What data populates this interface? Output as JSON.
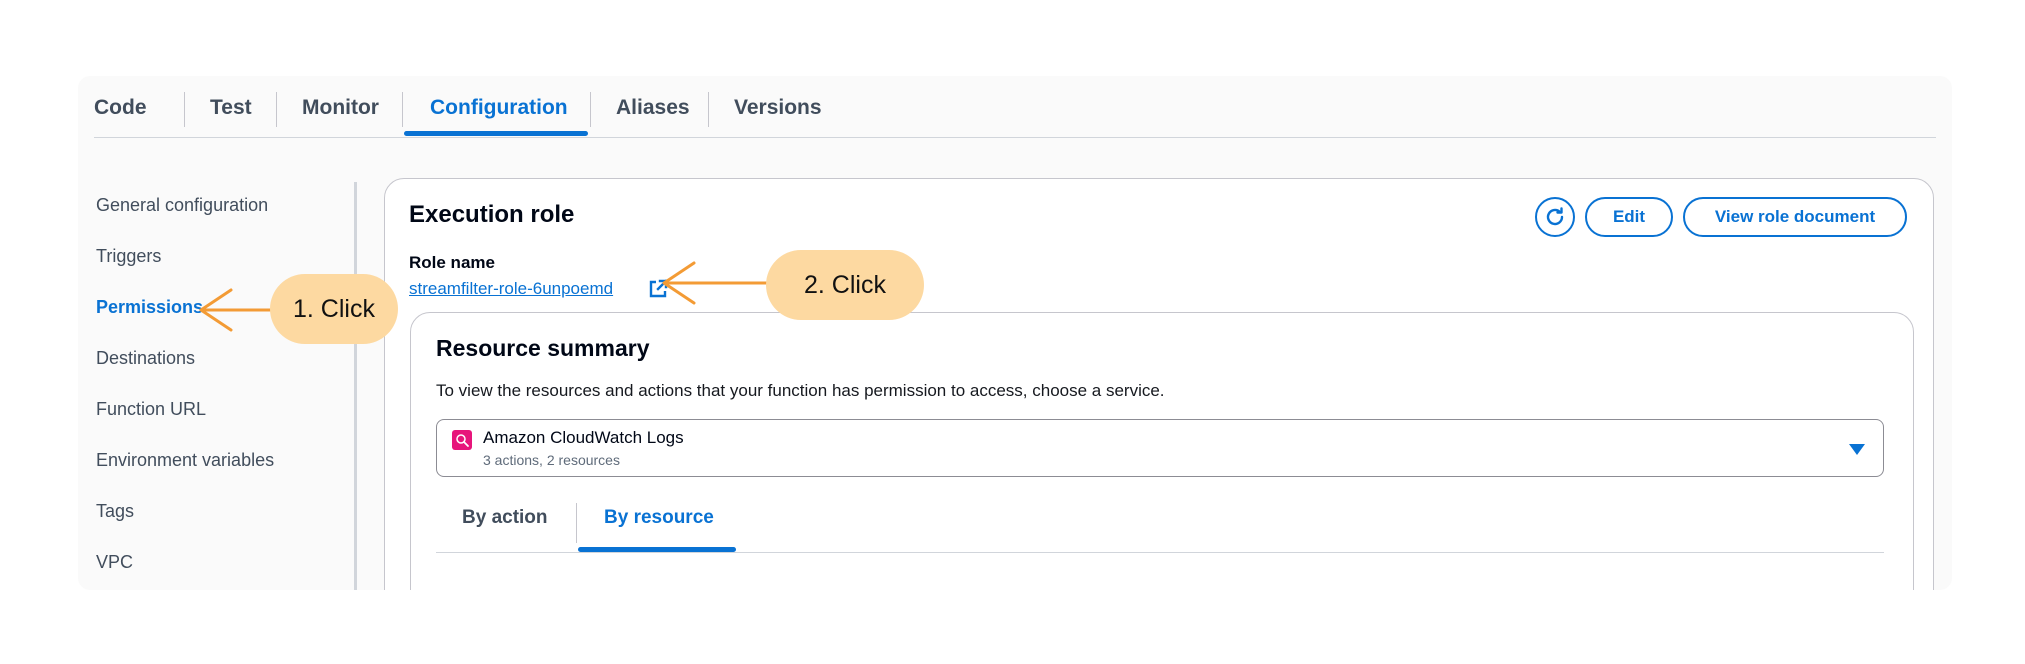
{
  "tabs": [
    {
      "label": "Code",
      "active": false
    },
    {
      "label": "Test",
      "active": false
    },
    {
      "label": "Monitor",
      "active": false
    },
    {
      "label": "Configuration",
      "active": true
    },
    {
      "label": "Aliases",
      "active": false
    },
    {
      "label": "Versions",
      "active": false
    }
  ],
  "sidebar": {
    "items": [
      {
        "label": "General configuration",
        "active": false
      },
      {
        "label": "Triggers",
        "active": false
      },
      {
        "label": "Permissions",
        "active": true
      },
      {
        "label": "Destinations",
        "active": false
      },
      {
        "label": "Function URL",
        "active": false
      },
      {
        "label": "Environment variables",
        "active": false
      },
      {
        "label": "Tags",
        "active": false
      },
      {
        "label": "VPC",
        "active": false
      }
    ]
  },
  "execution_role": {
    "title": "Execution role",
    "role_name_label": "Role name",
    "role_name": "streamfilter-role-6unpoemd",
    "edit_label": "Edit",
    "view_document_label": "View role document",
    "refresh_icon": "refresh-icon",
    "external_link_icon": "external-link-icon"
  },
  "resource_summary": {
    "title": "Resource summary",
    "description": "To view the resources and actions that your function has permission to access, choose a service.",
    "service": {
      "name": "Amazon CloudWatch Logs",
      "meta": "3 actions, 2 resources",
      "icon": "cloudwatch-logs-icon",
      "icon_color": "#e7157b"
    },
    "subtabs": [
      {
        "label": "By action",
        "active": false
      },
      {
        "label": "By resource",
        "active": true
      }
    ]
  },
  "annotations": [
    {
      "label": "1. Click"
    },
    {
      "label": "2. Click"
    }
  ],
  "colors": {
    "accent": "#0972d3",
    "annotation_bubble": "#fdd9a1",
    "annotation_arrow": "#f39b35"
  }
}
